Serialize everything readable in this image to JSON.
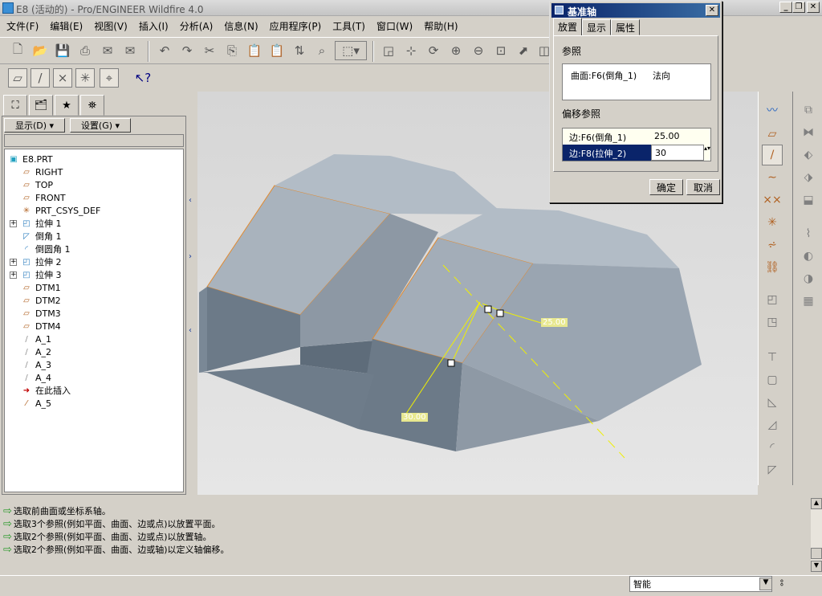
{
  "app": {
    "title": "E8 (活动的) - Pro/ENGINEER Wildfire 4.0"
  },
  "menu": [
    "文件(F)",
    "编辑(E)",
    "视图(V)",
    "插入(I)",
    "分析(A)",
    "信息(N)",
    "应用程序(P)",
    "工具(T)",
    "窗口(W)",
    "帮助(H)"
  ],
  "nav": {
    "show_label": "显示(D) ▾",
    "settings_label": "设置(G) ▾"
  },
  "tree": [
    {
      "label": "E8.PRT",
      "icon": "part-icon",
      "level": 0,
      "expand": ""
    },
    {
      "label": "RIGHT",
      "icon": "datum-plane-icon",
      "level": 1,
      "expand": ""
    },
    {
      "label": "TOP",
      "icon": "datum-plane-icon",
      "level": 1,
      "expand": ""
    },
    {
      "label": "FRONT",
      "icon": "datum-plane-icon",
      "level": 1,
      "expand": ""
    },
    {
      "label": "PRT_CSYS_DEF",
      "icon": "csys-icon",
      "level": 1,
      "expand": ""
    },
    {
      "label": "拉伸 1",
      "icon": "extrude-icon",
      "level": 1,
      "expand": "+"
    },
    {
      "label": "倒角 1",
      "icon": "chamfer-icon",
      "level": 1,
      "expand": ""
    },
    {
      "label": "倒圆角 1",
      "icon": "round-icon",
      "level": 1,
      "expand": ""
    },
    {
      "label": "拉伸 2",
      "icon": "extrude-icon",
      "level": 1,
      "expand": "+"
    },
    {
      "label": "拉伸 3",
      "icon": "extrude-icon",
      "level": 1,
      "expand": "+"
    },
    {
      "label": "DTM1",
      "icon": "datum-plane-icon",
      "level": 1,
      "expand": ""
    },
    {
      "label": "DTM2",
      "icon": "datum-plane-icon",
      "level": 1,
      "expand": ""
    },
    {
      "label": "DTM3",
      "icon": "datum-plane-icon",
      "level": 1,
      "expand": ""
    },
    {
      "label": "DTM4",
      "icon": "datum-plane-icon",
      "level": 1,
      "expand": ""
    },
    {
      "label": "A_1",
      "icon": "datum-axis-icon",
      "level": 1,
      "expand": ""
    },
    {
      "label": "A_2",
      "icon": "datum-axis-icon",
      "level": 1,
      "expand": ""
    },
    {
      "label": "A_3",
      "icon": "datum-axis-icon",
      "level": 1,
      "expand": ""
    },
    {
      "label": "A_4",
      "icon": "datum-axis-icon",
      "level": 1,
      "expand": ""
    },
    {
      "label": "在此插入",
      "icon": "insert-here-arrow-icon",
      "level": 1,
      "expand": ""
    },
    {
      "label": "A_5",
      "icon": "new-axis-icon",
      "level": 1,
      "expand": ""
    }
  ],
  "messages": [
    "选取前曲面或坐标系轴。",
    "选取3个参照(例如平面、曲面、边或点)以放置平面。",
    "选取2个参照(例如平面、曲面、边或点)以放置轴。",
    "选取2个参照(例如平面、曲面、边或轴)以定义轴偏移。"
  ],
  "status": {
    "filter": "智能"
  },
  "viewport": {
    "dim1": "25.00",
    "dim2": "30.00"
  },
  "dialog": {
    "title": "基准轴",
    "tabs": [
      "放置",
      "显示",
      "属性"
    ],
    "ref_label": "参照",
    "ref_item": {
      "name": "曲面:F6(倒角_1)",
      "constraint": "法向"
    },
    "offset_label": "偏移参照",
    "offsets": [
      {
        "ref": "边:F6(倒角_1)",
        "value": "25.00"
      },
      {
        "ref": "边:F8(拉伸_2)",
        "value": "30"
      }
    ],
    "ok": "确定",
    "cancel": "取消"
  },
  "colors": {
    "accent": "#0a246a",
    "model_edge": "#e08a30",
    "dim_line": "#f0f000"
  }
}
